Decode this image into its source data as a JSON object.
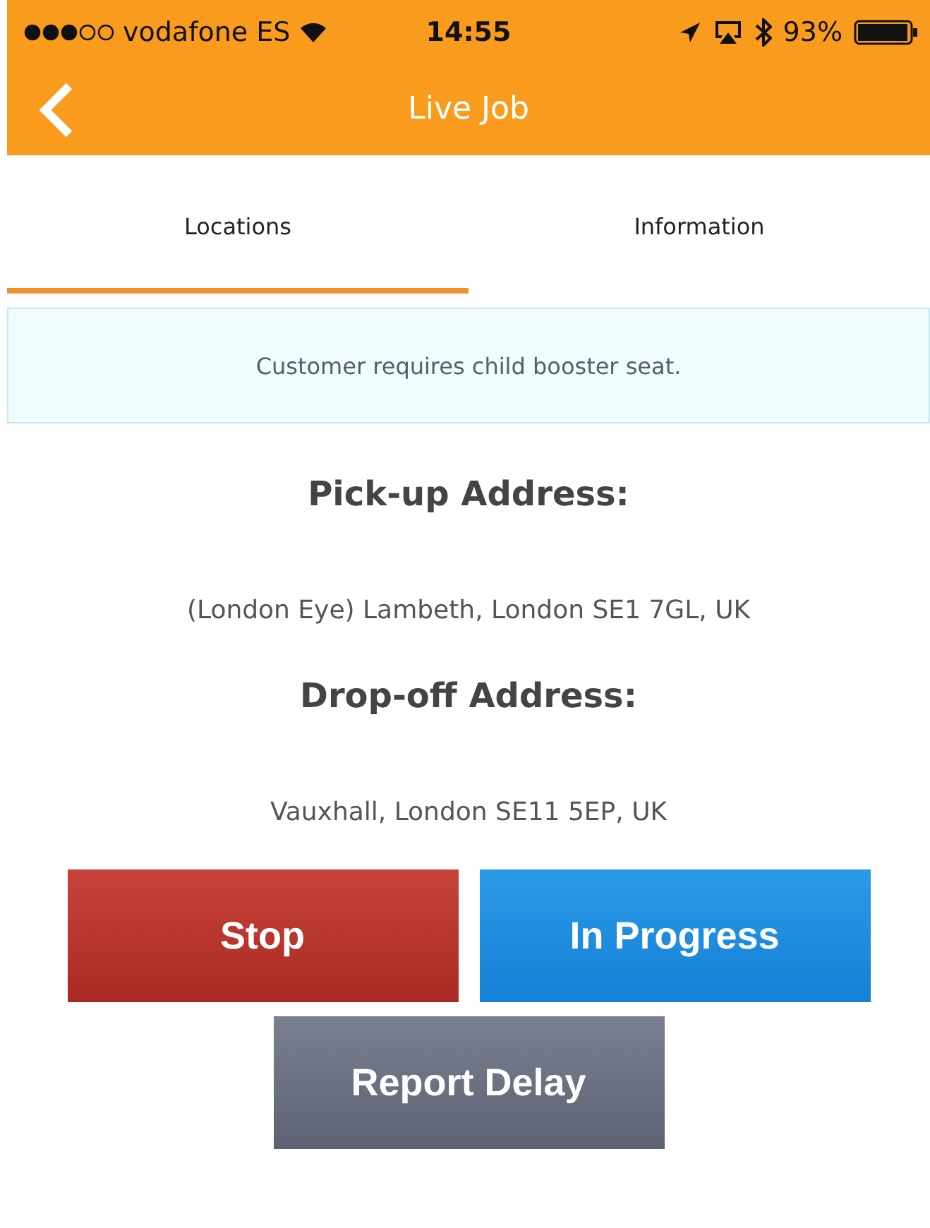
{
  "status_bar": {
    "carrier": "vodafone ES",
    "time": "14:55",
    "battery": "93%"
  },
  "header": {
    "title": "Live Job"
  },
  "tabs": [
    {
      "label": "Locations",
      "selected": true
    },
    {
      "label": "Information",
      "selected": false
    }
  ],
  "notice": "Customer requires child booster seat.",
  "sections": [
    {
      "heading": "Pick-up Address:",
      "address": "(London Eye) Lambeth, London SE1 7GL, UK"
    },
    {
      "heading": "Drop-off Address:",
      "address": "Vauxhall, London SE11 5EP, UK"
    }
  ],
  "buttons": [
    {
      "label": "Stop",
      "kind": "stop"
    },
    {
      "label": "In Progress",
      "kind": "progress"
    },
    {
      "label": "Report Delay",
      "kind": "delay"
    }
  ]
}
